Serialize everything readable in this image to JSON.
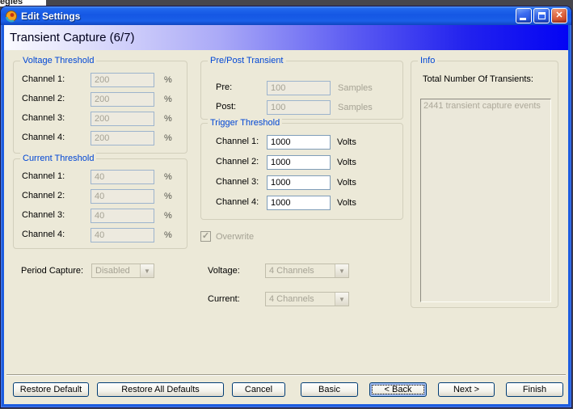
{
  "background": {
    "clipped_text": "egies"
  },
  "window": {
    "title": "Edit Settings"
  },
  "header": {
    "title": "Transient Capture (6/7)"
  },
  "icons": {
    "close": "✕",
    "dropdown": "▼",
    "check": "✓"
  },
  "voltage_threshold": {
    "title": "Voltage Threshold",
    "unit": "%",
    "labels": [
      "Channel 1:",
      "Channel 2:",
      "Channel 3:",
      "Channel 4:"
    ],
    "values": [
      "200",
      "200",
      "200",
      "200"
    ],
    "enabled": false
  },
  "current_threshold": {
    "title": "Current Threshold",
    "unit": "%",
    "labels": [
      "Channel 1:",
      "Channel 2:",
      "Channel 3:",
      "Channel 4:"
    ],
    "values": [
      "40",
      "40",
      "40",
      "40"
    ],
    "enabled": false
  },
  "prepost": {
    "title": "Pre/Post Transient",
    "unit": "Samples",
    "labels": [
      "Pre:",
      "Post:"
    ],
    "values": [
      "100",
      "100"
    ],
    "enabled": false
  },
  "trigger_threshold": {
    "title": "Trigger Threshold",
    "unit": "Volts",
    "labels": [
      "Channel 1:",
      "Channel 2:",
      "Channel 3:",
      "Channel 4:"
    ],
    "values": [
      "1000",
      "1000",
      "1000",
      "1000"
    ],
    "enabled": true
  },
  "info": {
    "title": "Info",
    "label": "Total Number Of Transients:",
    "items": [
      "2441 transient capture events"
    ]
  },
  "overwrite": {
    "label": "Overwrite",
    "checked": true
  },
  "period_capture": {
    "label": "Period Capture:",
    "value": "Disabled"
  },
  "voltage_select": {
    "label": "Voltage:",
    "value": "4 Channels"
  },
  "current_select": {
    "label": "Current:",
    "value": "4 Channels"
  },
  "buttons": {
    "restore_default": "Restore Default",
    "restore_all": "Restore All Defaults",
    "cancel": "Cancel",
    "basic": "Basic",
    "back": "< Back",
    "next": "Next >",
    "finish": "Finish"
  },
  "colors": {
    "titlebar_blue": "#1557E4",
    "banner_from": "#FBFBFF",
    "banner_to": "#0404F4",
    "body_beige": "#ECE9D8",
    "group_title_blue": "#0046D5",
    "disabled_text": "#A5A294",
    "field_border": "#7F9DB9",
    "button_border": "#003C74",
    "close_red": "#CC3D1C"
  }
}
